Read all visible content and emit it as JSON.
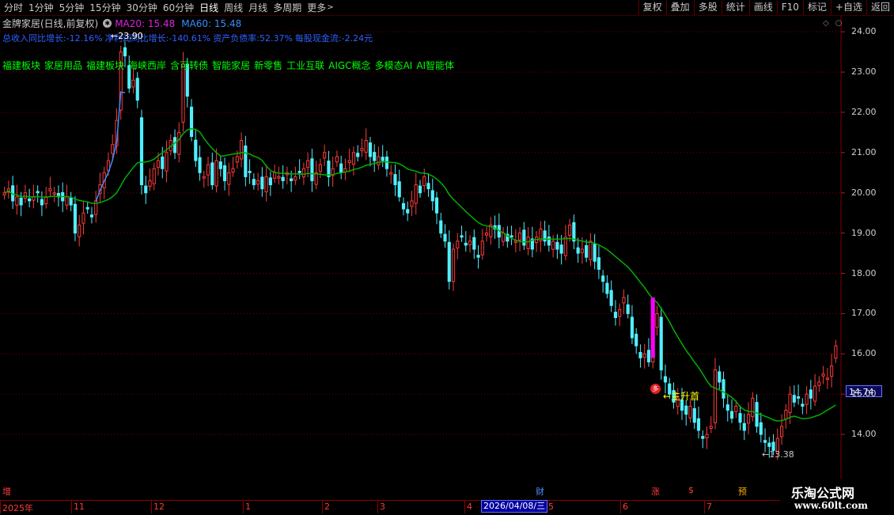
{
  "toolbar": {
    "periods": [
      "分时",
      "1分钟",
      "5分钟",
      "15分钟",
      "30分钟",
      "60分钟",
      "日线",
      "周线",
      "月线",
      "多周期",
      "更多"
    ],
    "active_period": "日线",
    "actions": [
      "复权",
      "叠加",
      "多股",
      "统计",
      "画线",
      "F10",
      "标记",
      "+自选",
      "返回"
    ]
  },
  "header": {
    "title": "金牌家居(日线,前复权)",
    "ma20_label": "MA20: 15.48",
    "ma60_label": "MA60: 15.48"
  },
  "fundamentals": [
    "总收入同比增长:-12.16%",
    "净利润同比增长:-140.61%",
    "资产负债率:52.37%",
    "每股现金流:-2.24元"
  ],
  "concepts": [
    "福建板块",
    "家居用品",
    "福建板块",
    "海峡西岸",
    "含可转债",
    "智能家居",
    "新零售",
    "工业互联",
    "AIGC概念",
    "多模态AI",
    "AI智能体"
  ],
  "current_price": "14.74",
  "annotations": {
    "high_label": "23.90",
    "low_label": "13.38",
    "signal_badge": "多",
    "signal_text": "主升首"
  },
  "events": {
    "left": "增",
    "cai": "财",
    "zhang": "涨",
    "s": "$",
    "shi": "预"
  },
  "x_axis": {
    "selected_date": "2026/04/08/三"
  },
  "watermark": {
    "line1": "乐淘公式网",
    "line2": "www.60lt.com"
  },
  "colors": {
    "up": "#ff3a3a",
    "down": "#4ff0ff",
    "ma_green": "#00b000",
    "ma_blue": "#3a8cff",
    "signal": "#ff00ff",
    "grid": "#7a0000"
  },
  "chart_data": {
    "type": "candlestick",
    "ylim": [
      13.0,
      24.2
    ],
    "yticks": [
      14.0,
      15.0,
      16.0,
      17.0,
      18.0,
      19.0,
      20.0,
      21.0,
      22.0,
      23.0,
      24.0
    ],
    "x_labels": [
      "2025年",
      "11",
      "12",
      "1",
      "2",
      "3",
      "4",
      "5",
      "6",
      "7"
    ],
    "closes": [
      20.0,
      20.1,
      19.8,
      19.9,
      19.7,
      20.0,
      19.8,
      19.9,
      20.0,
      19.7,
      19.9,
      20.1,
      20.0,
      19.9,
      19.8,
      19.9,
      19.7,
      19.0,
      19.2,
      19.5,
      19.6,
      19.4,
      19.8,
      20.2,
      20.5,
      20.8,
      21.2,
      21.8,
      23.5,
      23.4,
      22.6,
      22.8,
      22.3,
      20.2,
      20.0,
      20.3,
      20.6,
      20.8,
      20.6,
      21.0,
      21.3,
      21.0,
      21.5,
      23.2,
      22.4,
      21.4,
      20.8,
      20.5,
      20.4,
      20.7,
      20.2,
      20.8,
      20.6,
      20.3,
      20.5,
      20.6,
      20.9,
      21.3,
      20.4,
      20.5,
      20.2,
      20.3,
      20.1,
      20.4,
      20.2,
      20.5,
      20.4,
      20.3,
      20.5,
      20.3,
      20.4,
      20.5,
      20.6,
      20.8,
      20.3,
      20.5,
      20.7,
      21.0,
      20.4,
      20.6,
      20.9,
      20.5,
      20.6,
      20.8,
      21.0,
      20.9,
      21.1,
      21.3,
      20.9,
      20.8,
      20.9,
      20.8,
      20.6,
      20.5,
      20.2,
      19.9,
      19.6,
      19.5,
      19.8,
      20.2,
      20.0,
      20.4,
      20.1,
      19.8,
      19.5,
      19.0,
      18.8,
      17.8,
      18.6,
      18.8,
      18.9,
      18.7,
      18.8,
      18.6,
      18.4,
      18.8,
      19.0,
      19.2,
      19.1,
      18.9,
      19.0,
      18.8,
      18.9,
      18.8,
      19.0,
      18.7,
      18.9,
      18.6,
      18.9,
      19.1,
      18.8,
      18.7,
      18.8,
      18.6,
      18.5,
      18.9,
      19.2,
      18.8,
      18.5,
      18.6,
      18.4,
      18.8,
      18.3,
      18.1,
      17.8,
      17.5,
      17.2,
      16.9,
      17.1,
      17.4,
      17.0,
      16.4,
      16.2,
      15.9,
      16.0,
      15.8,
      16.6,
      17.0,
      15.6,
      15.3,
      15.0,
      14.8,
      14.9,
      14.6,
      14.5,
      14.7,
      14.3,
      14.1,
      13.9,
      14.0,
      14.2,
      15.6,
      15.3,
      14.9,
      14.6,
      14.4,
      14.7,
      14.3,
      14.1,
      14.5,
      14.9,
      14.2,
      14.0,
      13.8,
      13.7,
      13.6,
      13.9,
      14.2,
      14.6,
      15.0,
      14.8,
      14.9,
      14.7,
      15.0,
      14.9,
      15.2,
      15.3,
      15.5,
      15.4,
      15.7,
      16.2
    ]
  }
}
